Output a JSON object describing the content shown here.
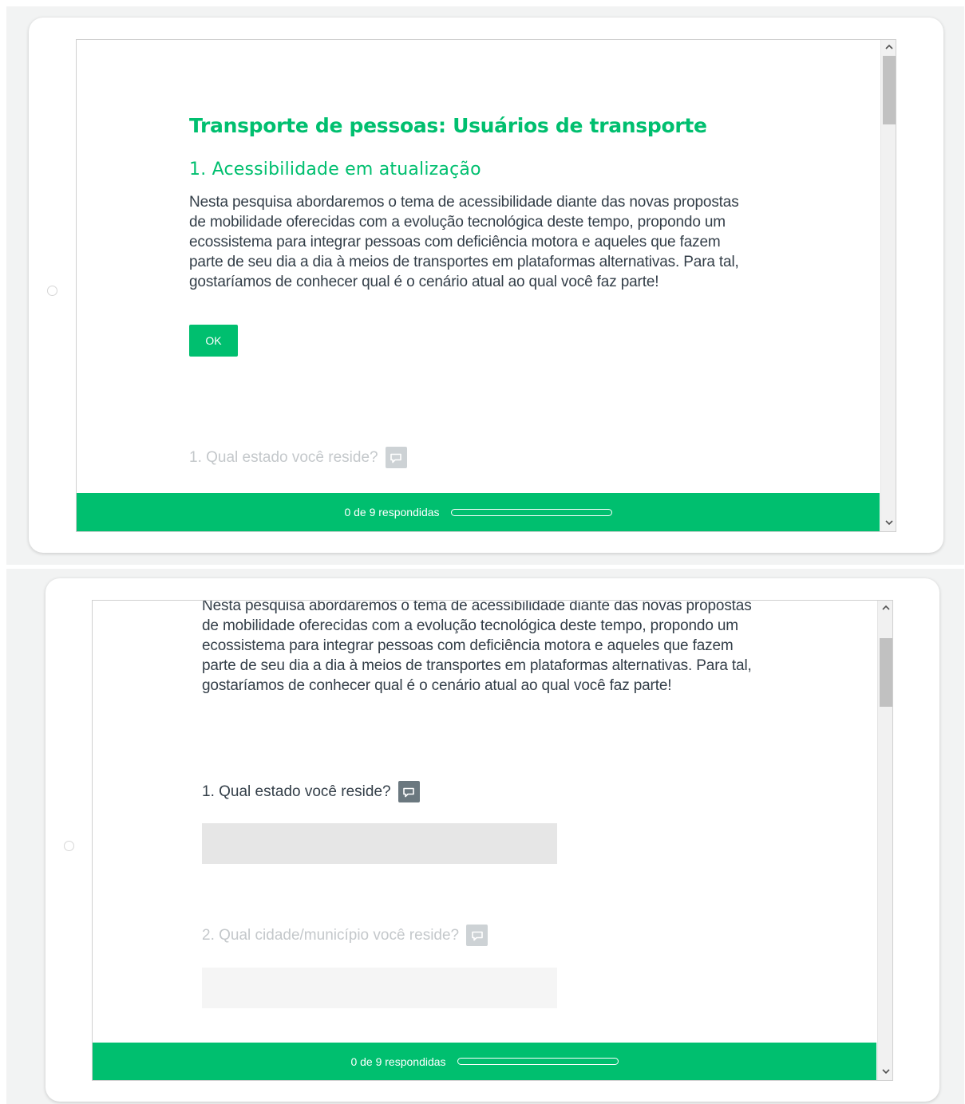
{
  "survey": {
    "title": "Transporte de pessoas: Usuários de transporte",
    "page_title": "1. Acessibilidade em atualização",
    "description_lines": [
      "Nesta pesquisa abordaremos o tema de acessibilidade diante das novas propostas",
      "de mobilidade oferecidas com a evolução tecnológica deste tempo, propondo um",
      "ecossistema para integrar pessoas com deficiência motora e aqueles que fazem",
      "parte de seu dia a dia à meios de transportes em plataformas alternativas. Para tal,",
      "gostaríamos de conhecer qual é o cenário atual ao qual você faz parte!"
    ],
    "ok_label": "OK",
    "questions": [
      {
        "label": "1. Qual estado você reside?"
      },
      {
        "label": "2. Qual cidade/município você reside?"
      }
    ]
  },
  "progress": {
    "label": "0 de 9 respondidas",
    "answered": 0,
    "total": 9
  },
  "colors": {
    "accent": "#00bf6f",
    "text": "#333e48",
    "faded_text": "#c4c8cb"
  },
  "icons": [
    "comment-icon",
    "chevron-up-icon",
    "chevron-down-icon"
  ]
}
